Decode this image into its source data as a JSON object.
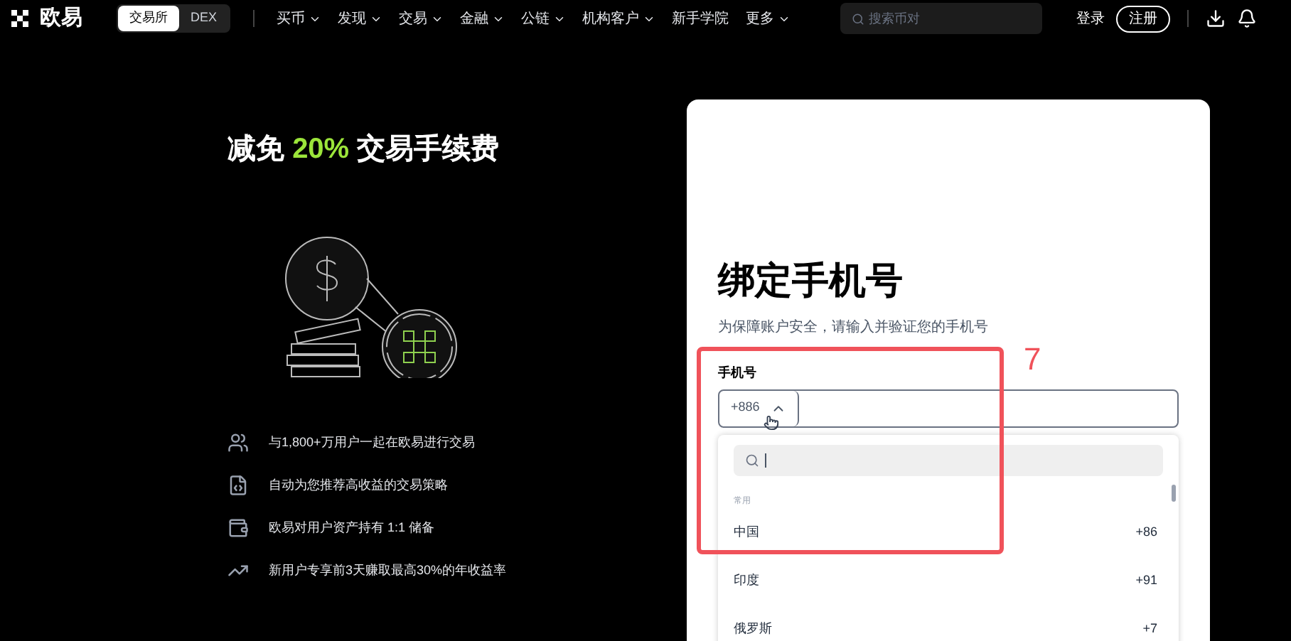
{
  "nav": {
    "logo": "欧易",
    "modes": [
      {
        "label": "交易所",
        "selected": true
      },
      {
        "label": "DEX",
        "selected": false
      }
    ],
    "menu": [
      {
        "label": "买币",
        "dropdown": true
      },
      {
        "label": "发现",
        "dropdown": true
      },
      {
        "label": "交易",
        "dropdown": true
      },
      {
        "label": "金融",
        "dropdown": true
      },
      {
        "label": "公链",
        "dropdown": true
      },
      {
        "label": "机构客户",
        "dropdown": true
      },
      {
        "label": "新手学院",
        "dropdown": false
      },
      {
        "label": "更多",
        "dropdown": true
      }
    ],
    "search": {
      "placeholder": "搜索币对"
    },
    "login": "登录",
    "register": "注册"
  },
  "promo": {
    "headline_start": "减免",
    "headline_highlight": "20%",
    "headline_end": "交易手续费",
    "features": [
      {
        "kind": "users",
        "text": "与1,800+万用户一起在欧易进行交易"
      },
      {
        "kind": "strategy",
        "text": "自动为您推荐高收益的交易策略"
      },
      {
        "kind": "reserve",
        "text": "欧易对用户资产持有 1:1 储备"
      },
      {
        "kind": "earn",
        "text": "新用户专享前3天赚取最高30%的年收益率"
      }
    ]
  },
  "form": {
    "title": "绑定手机号",
    "subtitle": "为保障账户安全，请输入并验证您的手机号",
    "phone_label": "手机号",
    "country_code": "+886",
    "dropdown_open": true,
    "dropdown": {
      "section": "常用",
      "countries": [
        {
          "name": "中国",
          "code": "+86"
        },
        {
          "name": "印度",
          "code": "+91"
        },
        {
          "name": "俄罗斯",
          "code": "+7"
        }
      ]
    }
  },
  "annotation": {
    "number": "7"
  }
}
